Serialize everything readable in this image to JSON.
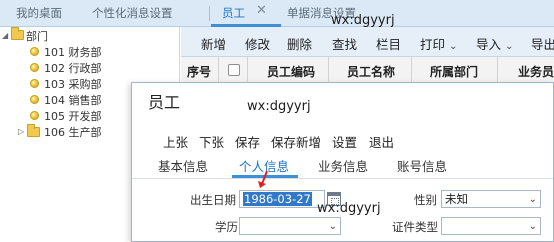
{
  "tabs": [
    {
      "label": "我的桌面"
    },
    {
      "label": "个性化消息设置"
    },
    {
      "label": "员工"
    },
    {
      "label": "单据消息设置"
    }
  ],
  "tab_close_glyph": "✕",
  "watermark": "wx:dgyyrj",
  "tree": {
    "root": "部门",
    "items": [
      {
        "label": "101 财务部"
      },
      {
        "label": "102 行政部"
      },
      {
        "label": "103 采购部"
      },
      {
        "label": "104 销售部"
      },
      {
        "label": "105 开发部"
      },
      {
        "label": "106 生产部"
      }
    ]
  },
  "toolbar": {
    "new": "新增",
    "edit": "修改",
    "delete": "删除",
    "find": "查找",
    "columns": "栏目",
    "print": "打印",
    "import": "导入",
    "export": "导出"
  },
  "grid": {
    "columns": [
      "序号",
      "员工编码",
      "员工名称",
      "所属部门",
      "业务员"
    ]
  },
  "dialog": {
    "title": "员工",
    "menu": [
      "上张",
      "下张",
      "保存",
      "保存新增",
      "设置",
      "退出"
    ],
    "tabs": [
      "基本信息",
      "个人信息",
      "业务信息",
      "账号信息"
    ],
    "fields": {
      "birth_label": "出生日期",
      "birth_value": "1986-03-27",
      "gender_label": "性别",
      "gender_value": "未知",
      "education_label": "学历",
      "education_value": "",
      "id_type_label": "证件类型",
      "id_type_value": ""
    }
  },
  "colors": {
    "accent": "#1a73c7",
    "selection": "#3179c8",
    "pointer": "#e02020"
  }
}
